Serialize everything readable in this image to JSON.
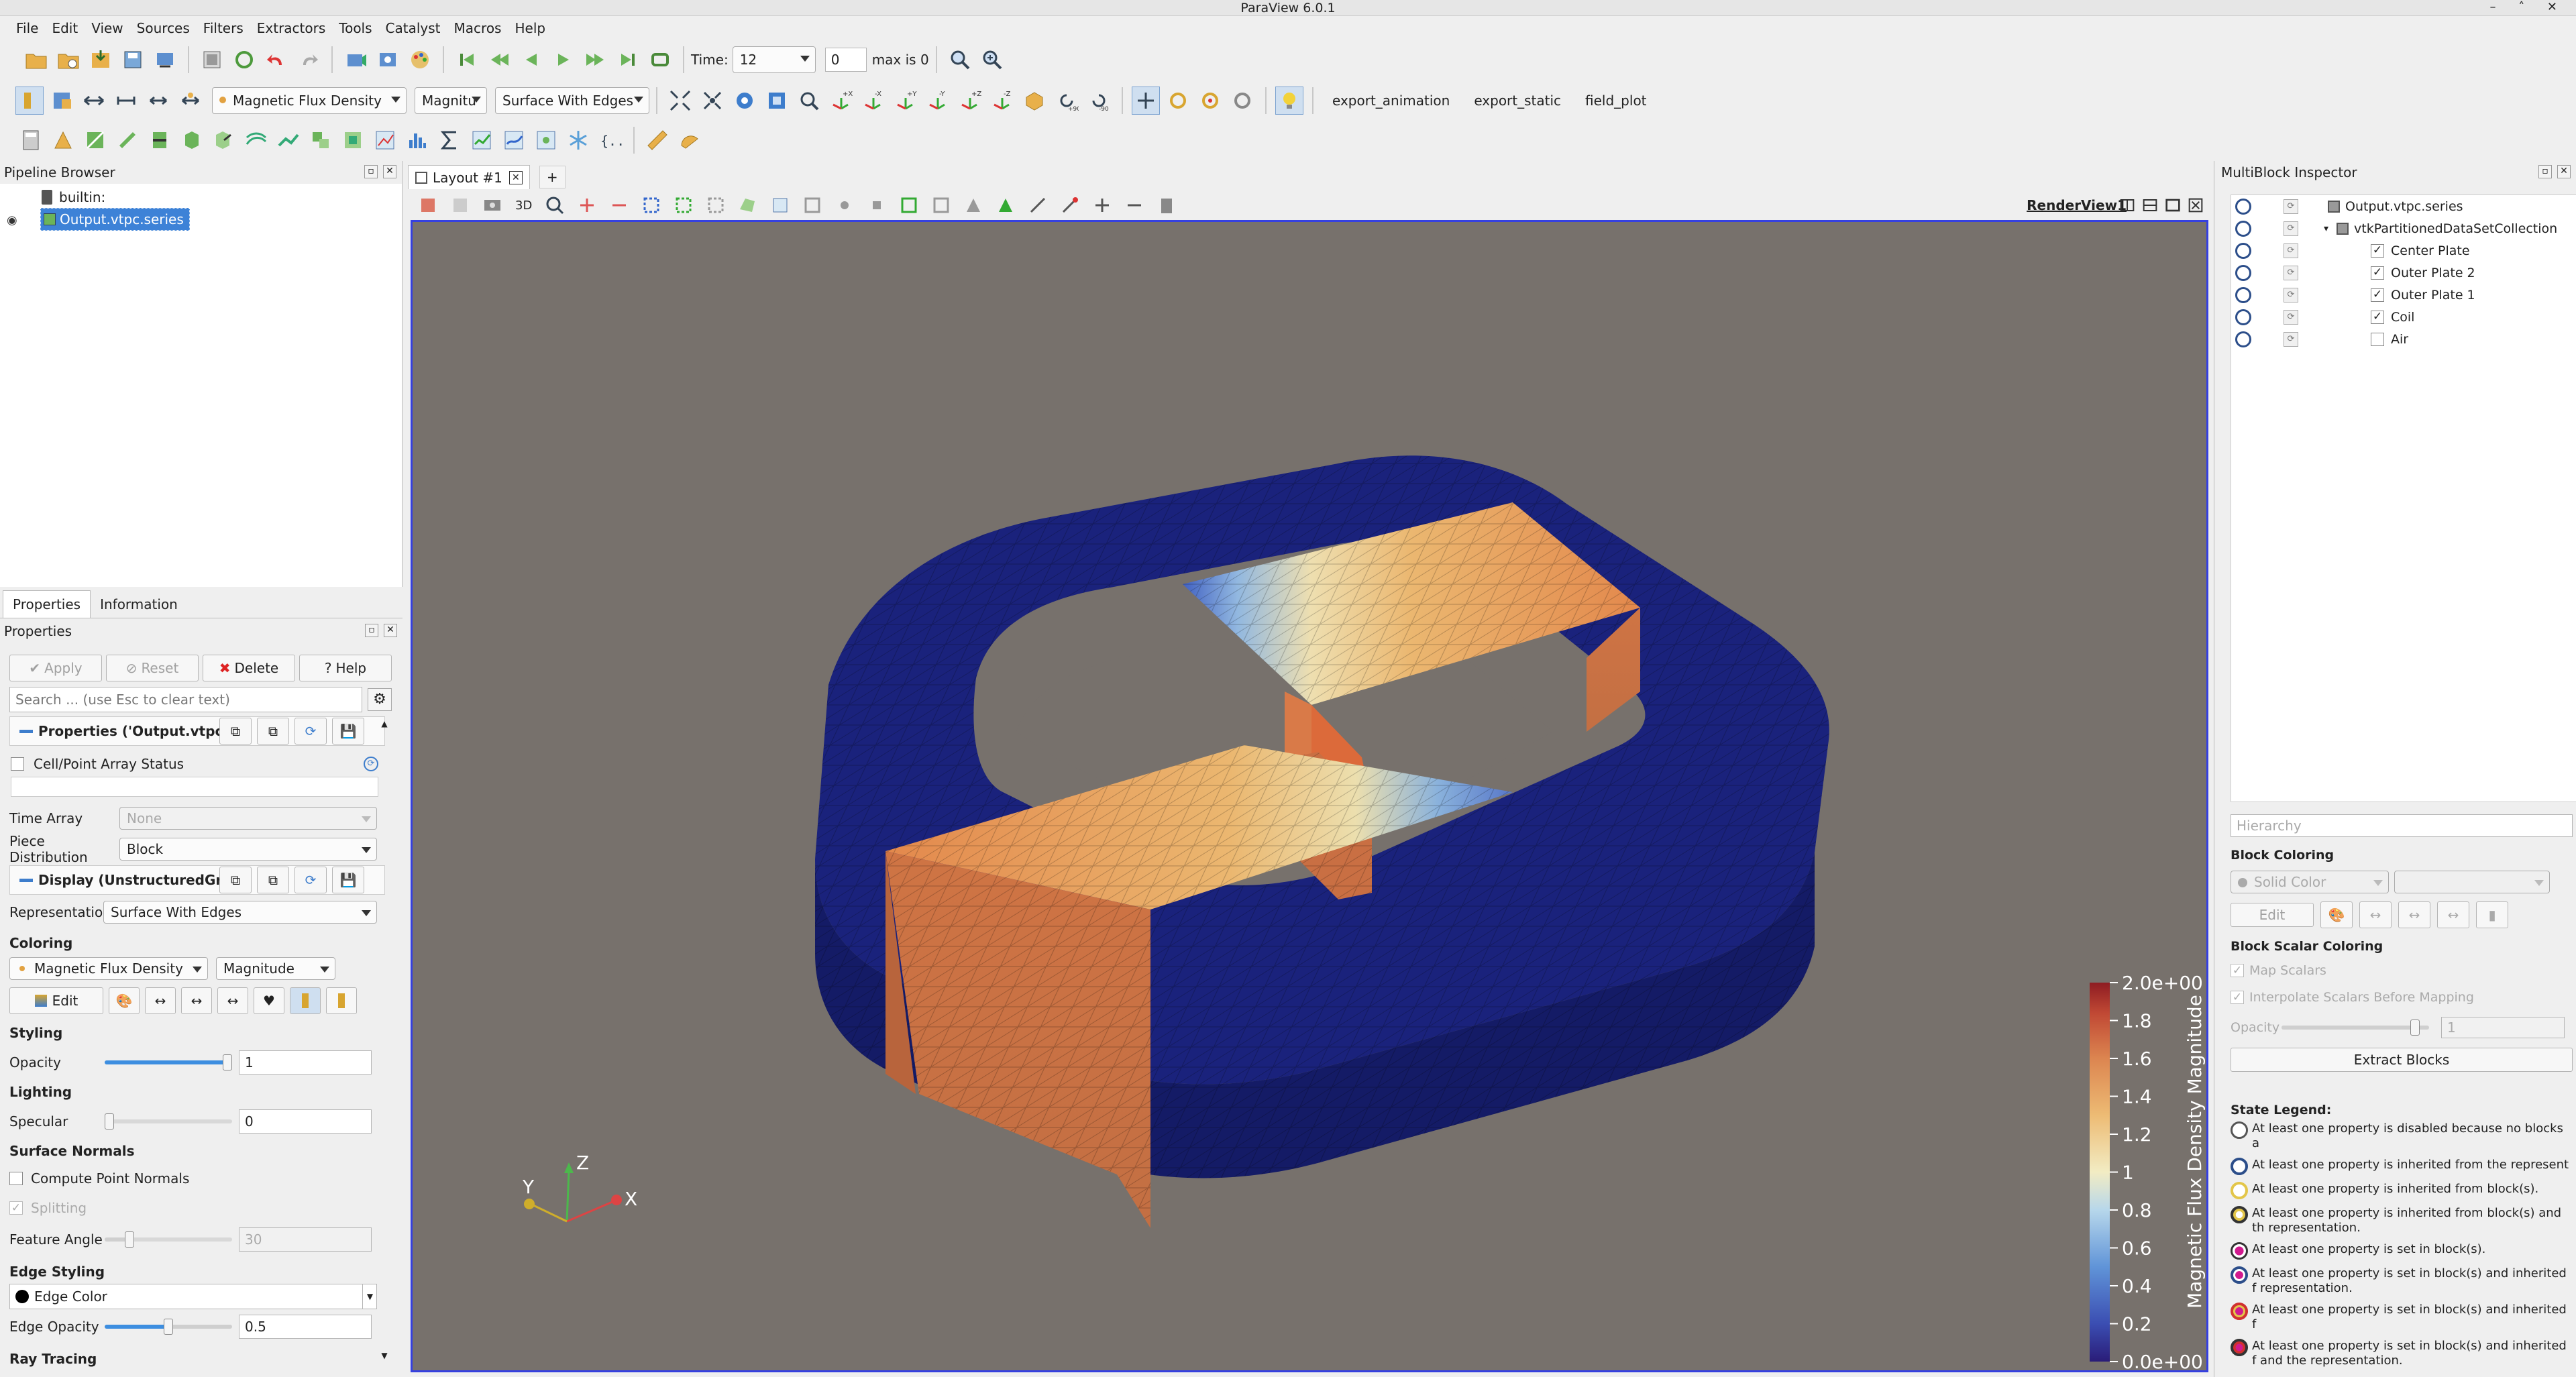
{
  "window": {
    "title": "ParaView 6.0.1"
  },
  "menu": [
    "File",
    "Edit",
    "View",
    "Sources",
    "Filters",
    "Extractors",
    "Tools",
    "Catalyst",
    "Macros",
    "Help"
  ],
  "time": {
    "label": "Time:",
    "value": "12",
    "index": "0",
    "max_label": "max is 0"
  },
  "toolbar2": {
    "array": "Magnetic Flux Density",
    "component": "Magnitu",
    "representation": "Surface With Edges"
  },
  "macros": [
    "export_animation",
    "export_static",
    "field_plot"
  ],
  "pipeline": {
    "title": "Pipeline Browser",
    "builtin": "builtin:",
    "source": "Output.vtpc.series"
  },
  "tabs": {
    "properties": "Properties",
    "information": "Information",
    "layout": "Layout #1",
    "add": "+"
  },
  "properties": {
    "title": "Properties",
    "apply": "Apply",
    "reset": "Reset",
    "delete": "Delete",
    "help": "Help",
    "search_placeholder": "Search ... (use Esc to clear text)",
    "group1": "Properties ('Output.vtpc.se",
    "cell_point": "Cell/Point Array Status",
    "time_array_label": "Time Array",
    "time_array_value": "None",
    "piece_label": "Piece Distribution",
    "piece_value": "Block",
    "group2": "Display (UnstructuredGrid",
    "repr_label": "Representation",
    "repr_value": "Surface With Edges",
    "coloring": "Coloring",
    "color_array": "Magnetic Flux Density",
    "color_comp": "Magnitude",
    "edit": "Edit",
    "styling": "Styling",
    "opacity_label": "Opacity",
    "opacity_value": "1",
    "opacity_level": 1.0,
    "lighting": "Lighting",
    "specular_label": "Specular",
    "specular_value": "0",
    "specular_level": 0.0,
    "surface_normals": "Surface Normals",
    "compute_normals": "Compute Point Normals",
    "splitting": "Splitting",
    "feature_angle_label": "Feature Angle",
    "feature_angle_value": "30",
    "feature_angle_level": 0.17,
    "edge_styling": "Edge Styling",
    "edge_color": "Edge Color",
    "edge_opacity_label": "Edge Opacity",
    "edge_opacity_value": "0.5",
    "edge_opacity_level": 0.5,
    "ray_tracing": "Ray Tracing"
  },
  "render": {
    "view_name": "RenderView1",
    "mode3d": "3D",
    "background": "#77716c"
  },
  "colorbar": {
    "title": "Magnetic Flux Density Magnitude",
    "ticks": [
      "2.0e+00",
      "1.8",
      "1.6",
      "1.4",
      "1.2",
      "1",
      "0.8",
      "0.6",
      "0.4",
      "0.2",
      "0.0e+00"
    ]
  },
  "axes": {
    "x": "X",
    "y": "Y",
    "z": "Z"
  },
  "inspector": {
    "title": "MultiBlock Inspector",
    "root": "Output.vtpc.series",
    "collection": "vtkPartitionedDataSetCollection",
    "blocks": [
      {
        "label": "Center Plate",
        "checked": true
      },
      {
        "label": "Outer Plate 2",
        "checked": true
      },
      {
        "label": "Outer Plate 1",
        "checked": true
      },
      {
        "label": "Coil",
        "checked": true
      },
      {
        "label": "Air",
        "checked": false
      }
    ],
    "hierarchy": "Hierarchy",
    "block_coloring": "Block Coloring",
    "solid_color": "Solid Color",
    "edit": "Edit",
    "block_scalar": "Block Scalar Coloring",
    "map_scalars": "Map Scalars",
    "interp": "Interpolate Scalars Before Mapping",
    "opacity": "Opacity",
    "opacity_value": "1",
    "opacity_level": 0.93,
    "extract": "Extract Blocks",
    "state_legend": "State Legend:",
    "legend": [
      {
        "text": "At least one property is disabled because no blocks a",
        "kind": "plain"
      },
      {
        "text": "At least one property is inherited from the represent",
        "kind": "blue"
      },
      {
        "text": "At least one property is inherited from block(s).",
        "kind": "yellow"
      },
      {
        "text": "At least one property is inherited from block(s) and th representation.",
        "kind": "yellowblue"
      },
      {
        "text": "At least one property is set in block(s).",
        "kind": "magenta"
      },
      {
        "text": "At least one property is set in block(s) and inherited f representation.",
        "kind": "magentablue"
      },
      {
        "text": "At least one property is set in block(s) and inherited f",
        "kind": "magentayellow"
      },
      {
        "text": "At least one property is set in block(s) and inherited f and the representation.",
        "kind": "magentaall"
      }
    ]
  }
}
